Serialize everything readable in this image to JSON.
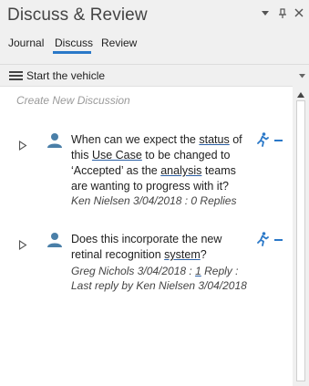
{
  "window": {
    "title": "Discuss & Review",
    "dropdown_icon": "chevron-down-icon",
    "pin_icon": "pin-icon",
    "close_icon": "close-icon"
  },
  "tabs": [
    {
      "label": "Journal",
      "active": false
    },
    {
      "label": "Discuss",
      "active": true
    },
    {
      "label": "Review",
      "active": false
    }
  ],
  "toolbar": {
    "context_label": "Start the vehicle",
    "menu_icon": "hamburger-icon"
  },
  "create_placeholder": "Create New Discussion",
  "discussions": [
    {
      "question_parts": [
        "When can we expect the ",
        "status",
        " of this ",
        "Use Case",
        " to be changed to ‘Accepted’ as the ",
        "analysis",
        " teams are wanting to progress with it?"
      ],
      "meta_parts": [
        "Ken Nielsen 3/04/2018 : 0 Replies"
      ]
    },
    {
      "question_parts": [
        "Does this incorporate the new retinal recognition ",
        "system",
        "?"
      ],
      "meta_parts": [
        "Greg Nichols 3/04/2018 : ",
        "1",
        " Reply : Last reply by Ken Nielsen 3/04/2018"
      ]
    }
  ],
  "colors": {
    "accent": "#2a78c8",
    "panel_bg": "#f0f0f0",
    "content_bg": "#ffffff",
    "placeholder": "#9a9a9a",
    "avatar": "#4a7fa8"
  }
}
